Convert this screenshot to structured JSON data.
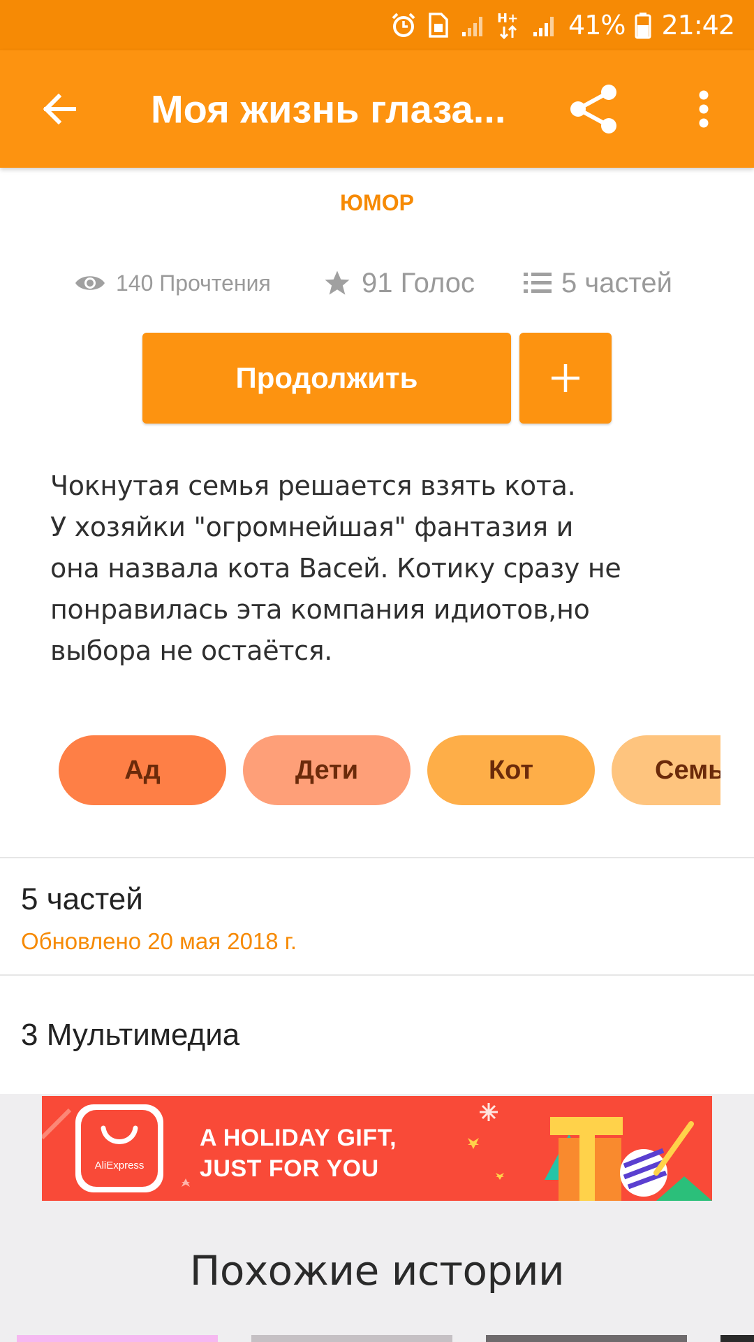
{
  "status_bar": {
    "battery": "41%",
    "time": "21:42",
    "icons": [
      "alarm-icon",
      "sim-icon",
      "signal-icon",
      "hplus-data-icon",
      "signal-icon",
      "battery-icon"
    ]
  },
  "toolbar": {
    "title": "Моя жизнь глаза...",
    "back_icon": "arrow-back-icon",
    "share_icon": "share-icon",
    "more_icon": "more-vert-icon"
  },
  "story": {
    "genre": "ЮМОР",
    "reads": "140 Прочтения",
    "votes": "91 Голос",
    "parts": "5 частей",
    "continue_label": "Продолжить",
    "add_icon": "plus-icon",
    "description": "Чокнутая семья решается взять кота.\nУ хозяйки \"огромнейшая\" фантазия и\nона назвала кота Васей. Котику сразу не\nпонравилась эта компания идиотов,но\nвыбора не остаётся."
  },
  "tags": [
    {
      "label": "Ад",
      "color": "#fe7f46"
    },
    {
      "label": "Дети",
      "color": "#fe9f78"
    },
    {
      "label": "Кот",
      "color": "#feae48"
    },
    {
      "label": "Семья",
      "color": "#fec47e"
    }
  ],
  "parts_section": {
    "title": "5 частей",
    "updated": "Обновлено 20 мая 2018 г."
  },
  "media_section": {
    "title": "3 Мультимедиа"
  },
  "ad": {
    "logo_text": "AliExpress",
    "line1": "A HOLIDAY GIFT,",
    "line2": "JUST FOR YOU"
  },
  "similar": {
    "title": "Похожие истории"
  },
  "colors": {
    "accent": "#fd9310",
    "status_bar": "#f68a05",
    "muted": "#9a9a9a"
  }
}
